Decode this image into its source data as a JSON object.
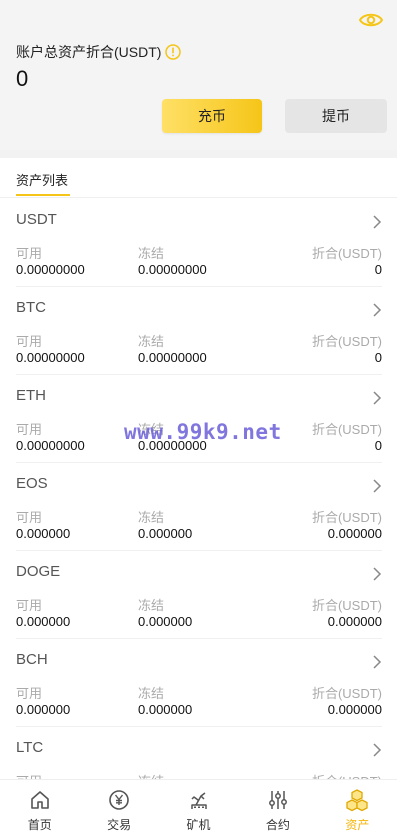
{
  "header": {
    "total_label": "账户总资产折合(USDT)",
    "total_value": "0",
    "deposit_label": "充币",
    "withdraw_label": "提币"
  },
  "tabs": {
    "asset_list_label": "资产列表"
  },
  "column_labels": {
    "available": "可用",
    "frozen": "冻结",
    "converted": "折合(USDT)"
  },
  "assets": [
    {
      "name": "USDT",
      "available": "0.00000000",
      "frozen": "0.00000000",
      "converted": "0"
    },
    {
      "name": "BTC",
      "available": "0.00000000",
      "frozen": "0.00000000",
      "converted": "0"
    },
    {
      "name": "ETH",
      "available": "0.00000000",
      "frozen": "0.00000000",
      "converted": "0"
    },
    {
      "name": "EOS",
      "available": "0.000000",
      "frozen": "0.000000",
      "converted": "0.000000"
    },
    {
      "name": "DOGE",
      "available": "0.000000",
      "frozen": "0.000000",
      "converted": "0.000000"
    },
    {
      "name": "BCH",
      "available": "0.000000",
      "frozen": "0.000000",
      "converted": "0.000000"
    },
    {
      "name": "LTC",
      "available": "",
      "frozen": "",
      "converted": ""
    }
  ],
  "watermark": "www.99k9.net",
  "tabbar": [
    {
      "label": "首页",
      "icon": "home-icon"
    },
    {
      "label": "交易",
      "icon": "yen-icon"
    },
    {
      "label": "矿机",
      "icon": "mining-machine-icon"
    },
    {
      "label": "合约",
      "icon": "sliders-icon"
    },
    {
      "label": "资产",
      "icon": "cubes-icon",
      "active": true
    }
  ],
  "colors": {
    "accent": "#f5c518",
    "active_tab_text": "#f5b50a",
    "header_bg": "#f4f4f4"
  }
}
